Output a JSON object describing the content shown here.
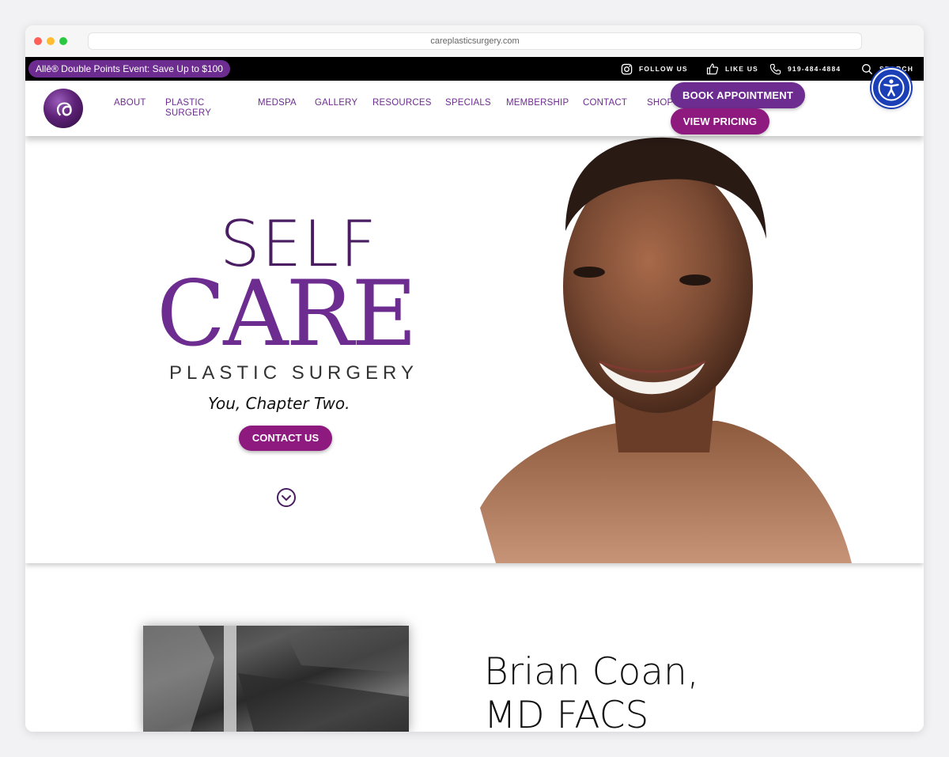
{
  "browser": {
    "url": "careplasticsurgery.com"
  },
  "topbar": {
    "promo": "Allē® Double Points Event: Save Up to $100",
    "follow": "FOLLOW US",
    "like": "LIKE US",
    "phone": "919-484-4884",
    "search": "SEARCH"
  },
  "nav": {
    "logo": "ര",
    "items": [
      "ABOUT",
      "PLASTIC SURGERY",
      "MEDSPA",
      "GALLERY",
      "RESOURCES",
      "SPECIALS",
      "MEMBERSHIP",
      "CONTACT",
      "SHOP"
    ],
    "book": "BOOK APPOINTMENT",
    "pricing": "VIEW PRICING"
  },
  "hero": {
    "self": "SELF",
    "care": "CARE",
    "plastic_surgery": "PLASTIC SURGERY",
    "tagline": "You, Chapter Two.",
    "cta": "CONTACT US"
  },
  "doctor": {
    "name_line1": "Brian Coan,",
    "name_line2": "MD FACS"
  },
  "colors": {
    "brand_purple": "#6d2c8f",
    "brand_magenta": "#8e1a80",
    "accessibility_blue": "#1b3fb6"
  },
  "icons": [
    "instagram-icon",
    "thumbs-up-icon",
    "phone-icon",
    "search-icon",
    "accessibility-icon",
    "chevron-down-circle-icon"
  ]
}
